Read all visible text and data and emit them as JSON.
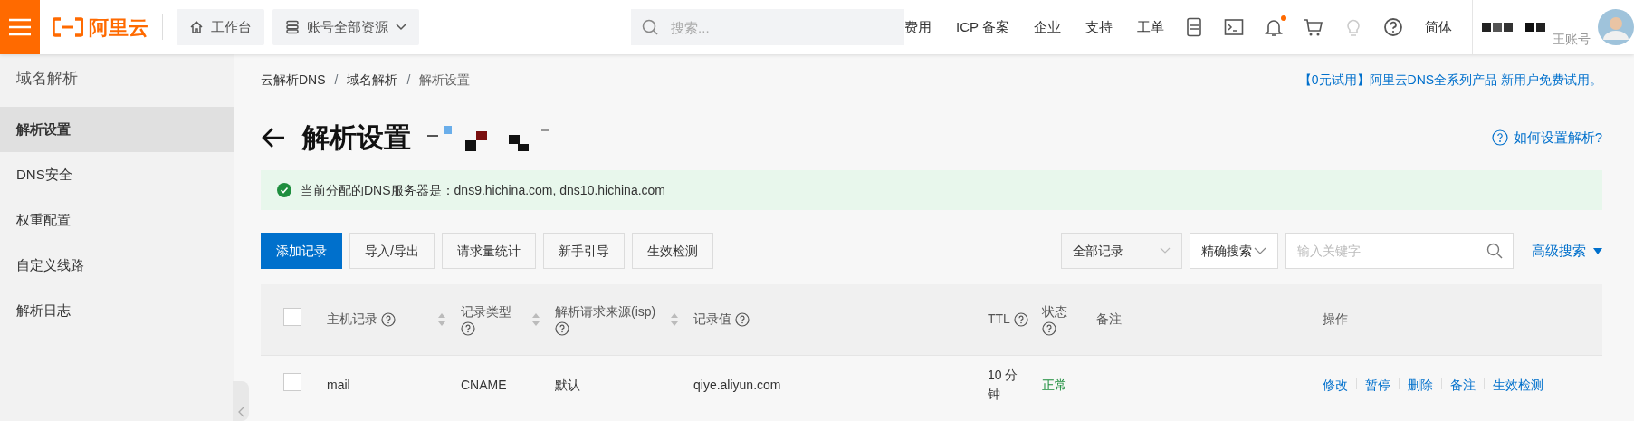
{
  "topbar": {
    "logo_text": "阿里云",
    "workbench": "工作台",
    "resource_menu": "账号全部资源",
    "search_placeholder": "搜索...",
    "links": [
      "费用",
      "ICP 备案",
      "企业",
      "支持",
      "工单"
    ],
    "notification_dot": true,
    "language": "简体",
    "user_name": "王账号"
  },
  "sidebar": {
    "title": "域名解析",
    "items": [
      {
        "label": "解析设置",
        "selected": true
      },
      {
        "label": "DNS安全",
        "selected": false
      },
      {
        "label": "权重配置",
        "selected": false
      },
      {
        "label": "自定义线路",
        "selected": false
      },
      {
        "label": "解析日志",
        "selected": false
      }
    ]
  },
  "breadcrumb": [
    "云解析DNS",
    "域名解析",
    "解析设置"
  ],
  "breadcrumb_separators": [
    "/",
    "/"
  ],
  "promo": "【0元试用】阿里云DNS全系列产品 新用户免费试用。",
  "page_title": "解析设置",
  "help_link": "如何设置解析?",
  "alert": {
    "kind": "success",
    "text": "当前分配的DNS服务器是：dns9.hichina.com, dns10.hichina.com"
  },
  "actions": [
    {
      "label": "添加记录",
      "primary": true
    },
    {
      "label": "导入/导出",
      "primary": false
    },
    {
      "label": "请求量统计",
      "primary": false
    },
    {
      "label": "新手引导",
      "primary": false
    },
    {
      "label": "生效检测",
      "primary": false
    }
  ],
  "filters": {
    "record_filter": "全部记录",
    "search_mode": "精确搜索",
    "keyword_placeholder": "输入关键字",
    "advanced": "高级搜索"
  },
  "table": {
    "select_all_checked": false,
    "columns": [
      {
        "label": "主机记录",
        "help": true,
        "sortable": true
      },
      {
        "label": "记录类型",
        "help": true,
        "sortable": true
      },
      {
        "label": "解析请求来源(isp)",
        "help": true,
        "sortable": true
      },
      {
        "label": "记录值",
        "help": true,
        "sortable": false
      },
      {
        "label": "TTL",
        "help": true,
        "sortable": false
      },
      {
        "label": "状态",
        "help": true,
        "sortable": false
      },
      {
        "label": "备注",
        "help": false,
        "sortable": false
      },
      {
        "label": "操作",
        "help": false,
        "sortable": false
      }
    ],
    "rows": [
      {
        "checked": false,
        "host": "mail",
        "type": "CNAME",
        "isp": "默认",
        "value": "qiye.aliyun.com",
        "ttl": "10 分钟",
        "status": {
          "text": "正常",
          "kind": "ok"
        },
        "operations": [
          "修改",
          "暂停",
          "删除",
          "备注",
          "生效检测"
        ]
      }
    ]
  }
}
